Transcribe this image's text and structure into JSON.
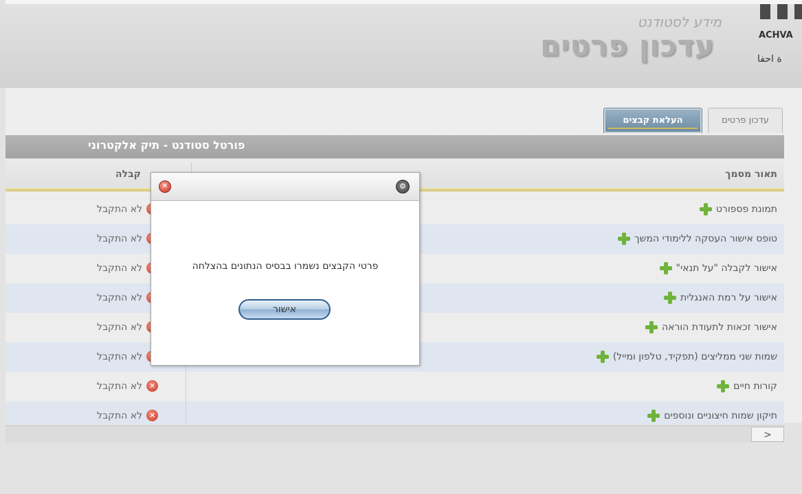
{
  "header": {
    "subtitle": "מידע לסטודנט",
    "title": "עדכון פרטים",
    "logo_text_en": "ACHVA",
    "logo_text_ar": "ة احفا"
  },
  "tabs": [
    {
      "label": "עדכון פרטים",
      "active": false
    },
    {
      "label": "העלאת קבצים",
      "active": true
    }
  ],
  "portal": {
    "title": "פורטל סטודנט - תיק אלקטרוני"
  },
  "table": {
    "columns": {
      "description": "תאור מסמך",
      "status": "קבלה"
    },
    "rows": [
      {
        "description": "תמונת פספורט",
        "status": "לא התקבל"
      },
      {
        "description": "טופס אישור העסקה ללימודי המשך",
        "status": "לא התקבל"
      },
      {
        "description": "אישור לקבלה \"על תנאי\"",
        "status": "לא התקבל"
      },
      {
        "description": "אישור על רמת האנגלית",
        "status": "לא התקבל"
      },
      {
        "description": "אישור זכאות לתעודת הוראה",
        "status": "לא התקבל"
      },
      {
        "description": "שמות שני ממליצים (תפקיד, טלפון ומייל)",
        "status": "לא התקבל"
      },
      {
        "description": "קורות חיים",
        "status": "לא התקבל"
      },
      {
        "description": "תיקון שמות חיצוניים ונוספים",
        "status": "לא התקבל"
      }
    ]
  },
  "dialog": {
    "message": "פרטי הקבצים נשמרו בבסיס הנתונים בהצלחה",
    "ok_label": "אישור"
  },
  "scrollbar": {
    "arrow": ">"
  },
  "colors": {
    "accent_tab": "#7f9bb3",
    "plus_icon": "#6fb33b",
    "status_x": "#c93a2a",
    "ok_button_border": "#2d5d8d"
  }
}
